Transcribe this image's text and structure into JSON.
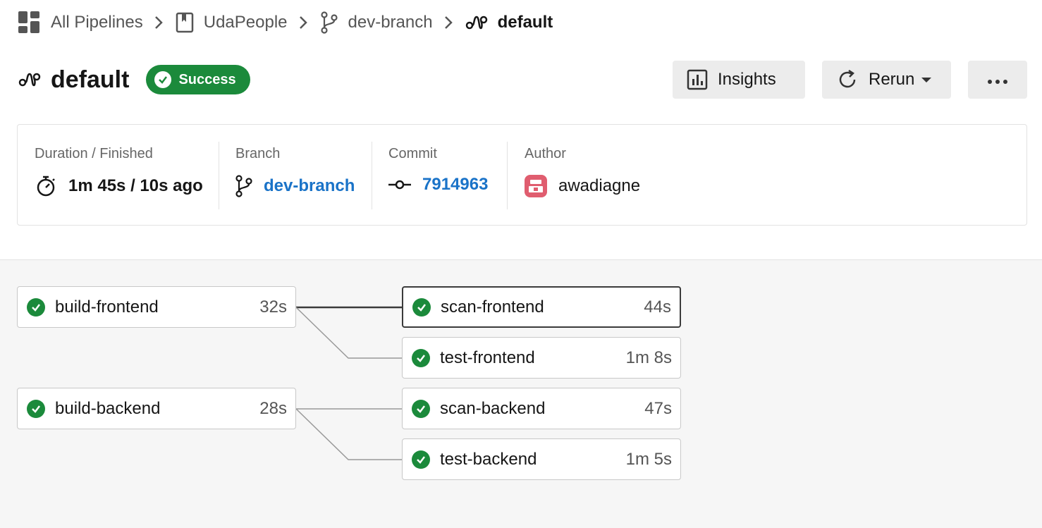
{
  "breadcrumb": {
    "items": [
      {
        "label": "All Pipelines",
        "icon": "grid-icon"
      },
      {
        "label": "UdaPeople",
        "icon": "bookmark-icon"
      },
      {
        "label": "dev-branch",
        "icon": "branch-icon"
      },
      {
        "label": "default",
        "icon": "workflow-icon"
      }
    ]
  },
  "header": {
    "title": "default",
    "status": "Success",
    "insights_label": "Insights",
    "rerun_label": "Rerun"
  },
  "info": {
    "duration_label": "Duration / Finished",
    "duration_value": "1m 45s / 10s ago",
    "branch_label": "Branch",
    "branch_value": "dev-branch",
    "commit_label": "Commit",
    "commit_value": "7914963",
    "author_label": "Author",
    "author_value": "awadiagne"
  },
  "jobs": [
    {
      "name": "build-frontend",
      "duration": "32s",
      "status": "success"
    },
    {
      "name": "scan-frontend",
      "duration": "44s",
      "status": "success",
      "selected": true
    },
    {
      "name": "test-frontend",
      "duration": "1m 8s",
      "status": "success"
    },
    {
      "name": "build-backend",
      "duration": "28s",
      "status": "success"
    },
    {
      "name": "scan-backend",
      "duration": "47s",
      "status": "success"
    },
    {
      "name": "test-backend",
      "duration": "1m 5s",
      "status": "success"
    }
  ],
  "colors": {
    "success": "#1b8a3b",
    "link": "#1a73c8",
    "avatar": "#e05d6f"
  }
}
